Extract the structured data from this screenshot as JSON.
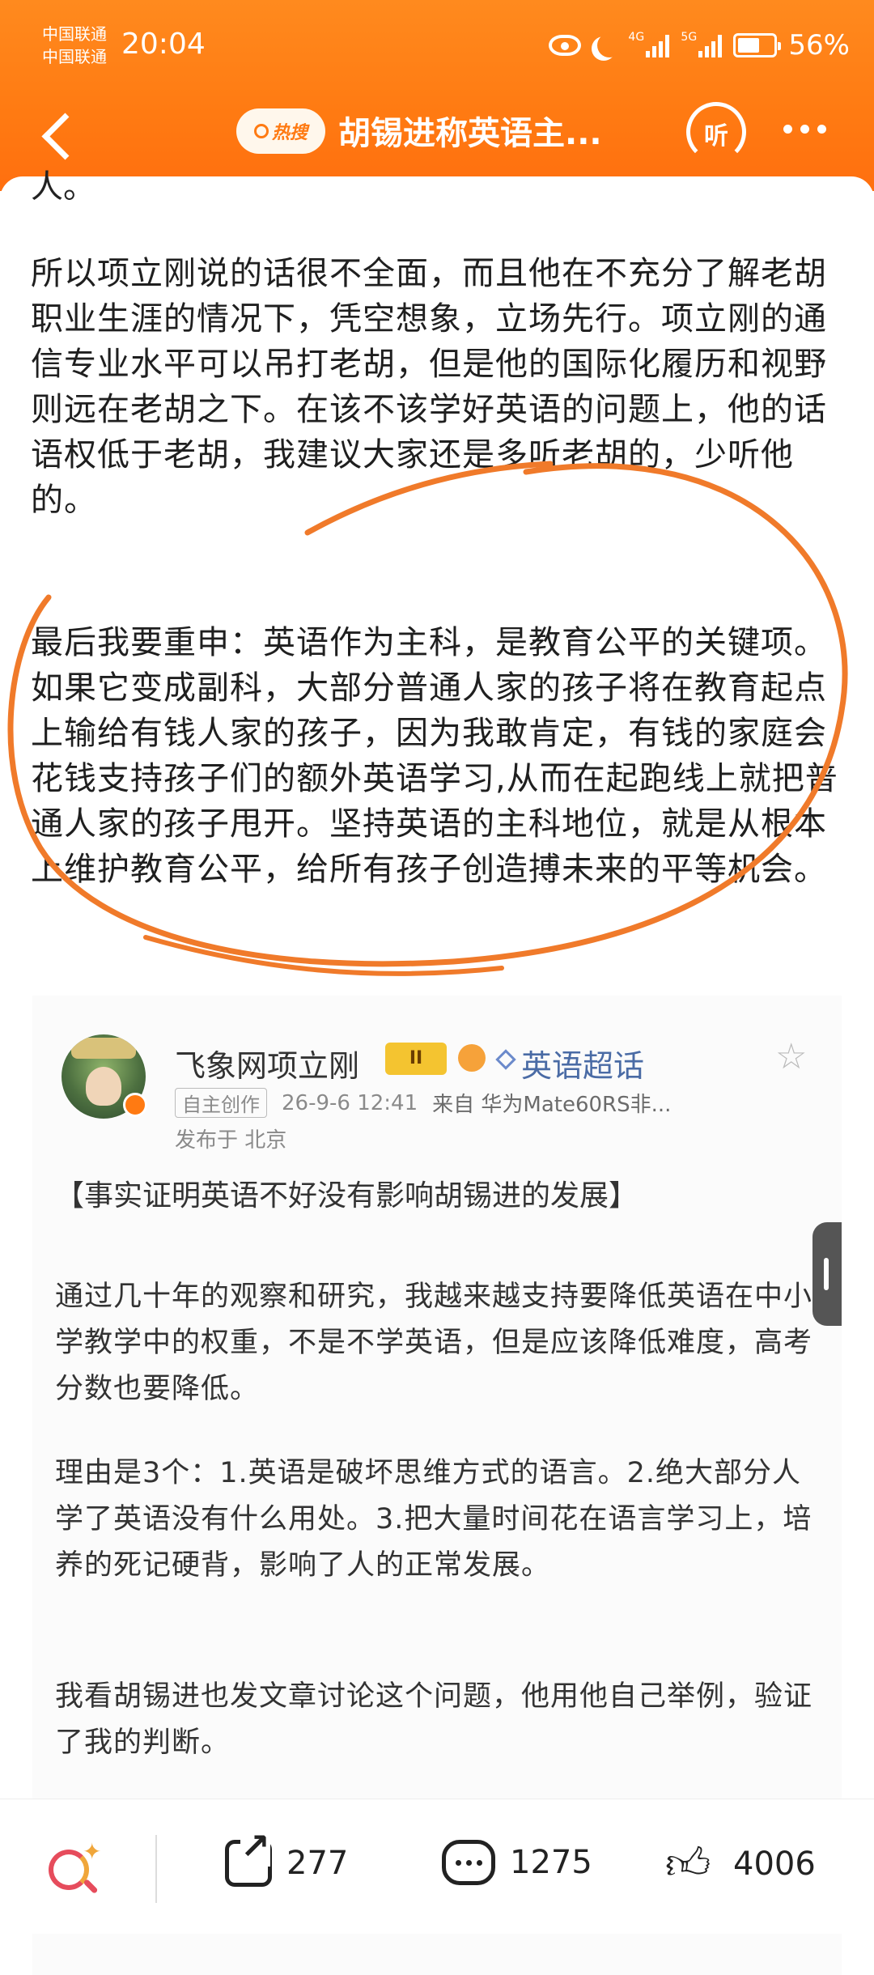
{
  "status": {
    "carrier1": "中国联通",
    "carrier2": "中国联通",
    "time": "20:04",
    "sig1_label": "4G",
    "sig2_label": "5G",
    "battery": "56%"
  },
  "nav": {
    "hot_label": "热搜",
    "title": "胡锡进称英语主...",
    "listen_label": "听"
  },
  "article": {
    "cutoff_text": "人。",
    "para1": "所以项立刚说的话很不全面，而且他在不充分了解老胡职业生涯的情况下，凭空想象，立场先行。项立刚的通信专业水平可以吊打老胡，但是他的国际化履历和视野则远在老胡之下。在该不该学好英语的问题上，他的话语权低于老胡，我建议大家还是多听老胡的，少听他的。",
    "para2": "最后我要重申：英语作为主科，是教育公平的关键项。如果它变成副科，大部分普通人家的孩子将在教育起点上输给有钱人家的孩子，因为我敢肯定，有钱的家庭会花钱支持孩子们的额外英语学习,从而在起跑线上就把普通人家的孩子甩开。坚持英语的主科地位，就是从根本上维护教育公平，给所有孩子创造搏未来的平等机会。"
  },
  "quoted": {
    "username": "飞象网项立刚",
    "badge_label": "II",
    "topic": "英语超话",
    "tag": "自主创作",
    "datetime": "26-9-6 12:41",
    "source": "来自 华为Mate60RS非...",
    "location": "发布于 北京",
    "title": "【事实证明英语不好没有影响胡锡进的发展】",
    "p1": "通过几十年的观察和研究，我越来越支持要降低英语在中小学教学中的权重，不是不学英语，但是应该降低难度，高考分数也要降低。",
    "p2": "理由是3个：1.英语是破坏思维方式的语言。2.绝大部分人学了英语没有什么用处。3.把大量时间花在语言学习上，培养的死记硬背，影响了人的正常发展。",
    "p3": "我看胡锡进也发文章讨论这个问题，他用他自己举例，验证了我的判断。"
  },
  "bottom": {
    "share_count": "277",
    "comment_count": "1275",
    "like_count": "4006"
  },
  "colors": {
    "header_orange": "#ff7a12",
    "annotation_orange": "#f07a2a",
    "topic_blue": "#4a6ba5"
  }
}
